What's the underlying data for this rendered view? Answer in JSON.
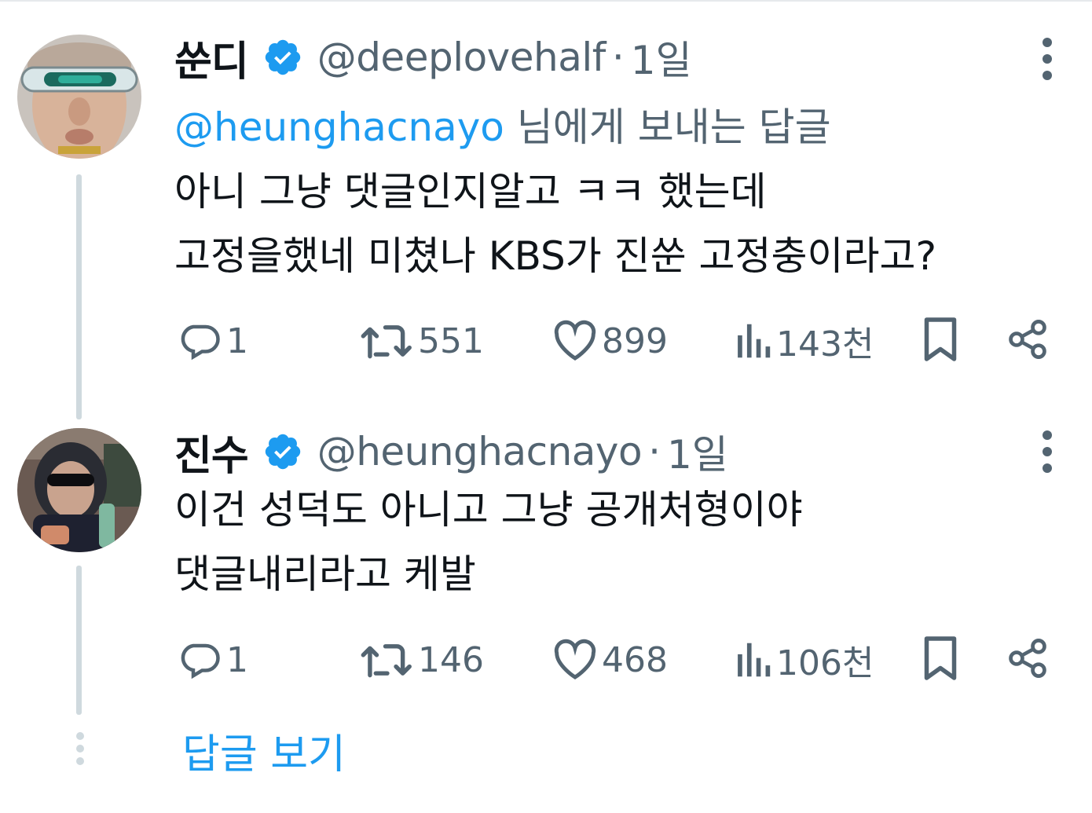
{
  "tweets": [
    {
      "display_name": "쑨디",
      "handle": "@deeplovehalf",
      "separator": "·",
      "time": "1일",
      "reply_to": {
        "mention": "@heunghacnayo",
        "suffix": " 님에게 보내는 답글"
      },
      "text_lines": [
        "아니 그냥 댓글인지알고 ㅋㅋ 했는데",
        "고정을했네 미쳤나 KBS가 진쑨 고정충이라고?"
      ],
      "replies": "1",
      "retweets": "551",
      "likes": "899",
      "views": "143천",
      "avatar_icon": "avatar-cyclops-visor"
    },
    {
      "display_name": "진수",
      "handle": "@heunghacnayo",
      "separator": "·",
      "time": "1일",
      "text_lines": [
        "이건 성덕도 아니고 그냥 공개처형이야",
        "댓글내리라고 케발"
      ],
      "replies": "1",
      "retweets": "146",
      "likes": "468",
      "views": "106천",
      "avatar_icon": "avatar-hooded-sunglasses"
    }
  ],
  "show_replies_label": "답글 보기",
  "colors": {
    "accent": "#1d9bf0",
    "text_primary": "#0f1419",
    "text_secondary": "#536471",
    "thread_line": "#cfd9de",
    "verified": "#1d9bf0"
  }
}
